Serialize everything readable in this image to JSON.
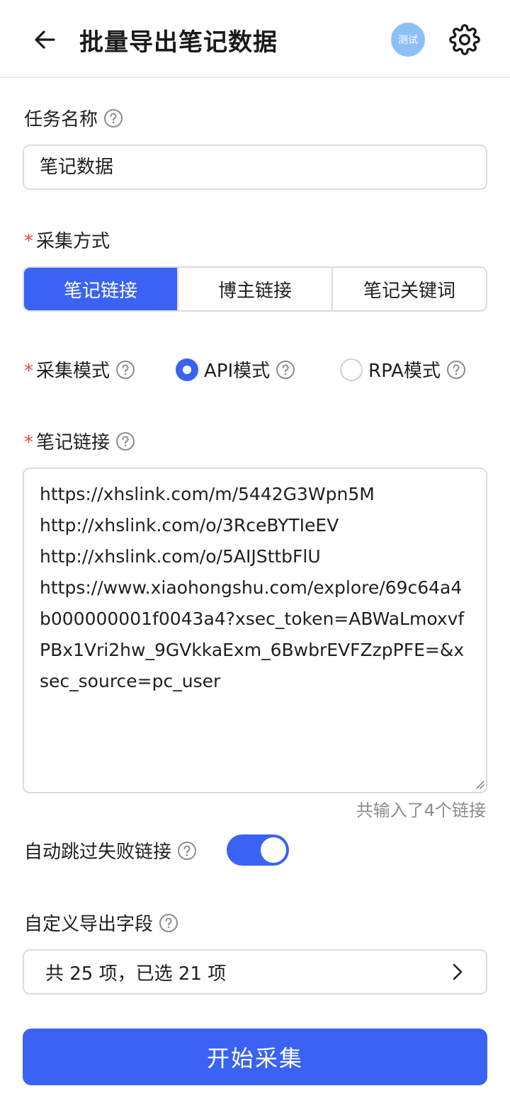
{
  "header": {
    "title": "批量导出笔记数据",
    "test_badge": "测试"
  },
  "task": {
    "label": "任务名称",
    "value": "笔记数据"
  },
  "collect_method": {
    "required_mark": "*",
    "label": "采集方式",
    "options": [
      "笔记链接",
      "博主链接",
      "笔记关键词"
    ],
    "selected": "笔记链接"
  },
  "collect_mode": {
    "required_mark": "*",
    "label": "采集模式",
    "options": [
      {
        "label": "API模式",
        "checked": true
      },
      {
        "label": "RPA模式",
        "checked": false
      }
    ]
  },
  "note_links": {
    "required_mark": "*",
    "label": "笔记链接",
    "value": "https://xhslink.com/m/5442G3Wpn5M\nhttp://xhslink.com/o/3RceBYTIeEV\nhttp://xhslink.com/o/5AIJSttbFlU\nhttps://www.xiaohongshu.com/explore/69c64a4b000000001f0043a4?xsec_token=ABWaLmoxvfPBx1Vri2hw_9GVkkaExm_6BwbrEVFZzpPFE=&xsec_source=pc_user",
    "count_text": "共输入了4个链接"
  },
  "auto_skip": {
    "label": "自动跳过失败链接",
    "enabled": true
  },
  "custom_fields": {
    "label": "自定义导出字段",
    "summary": "共 25 项，已选 21 项"
  },
  "start_button": {
    "label": "开始采集"
  },
  "colors": {
    "primary": "#3a63f3",
    "required": "#ef4444",
    "badge": "#8fc0f5",
    "muted": "#8c8c8c"
  }
}
